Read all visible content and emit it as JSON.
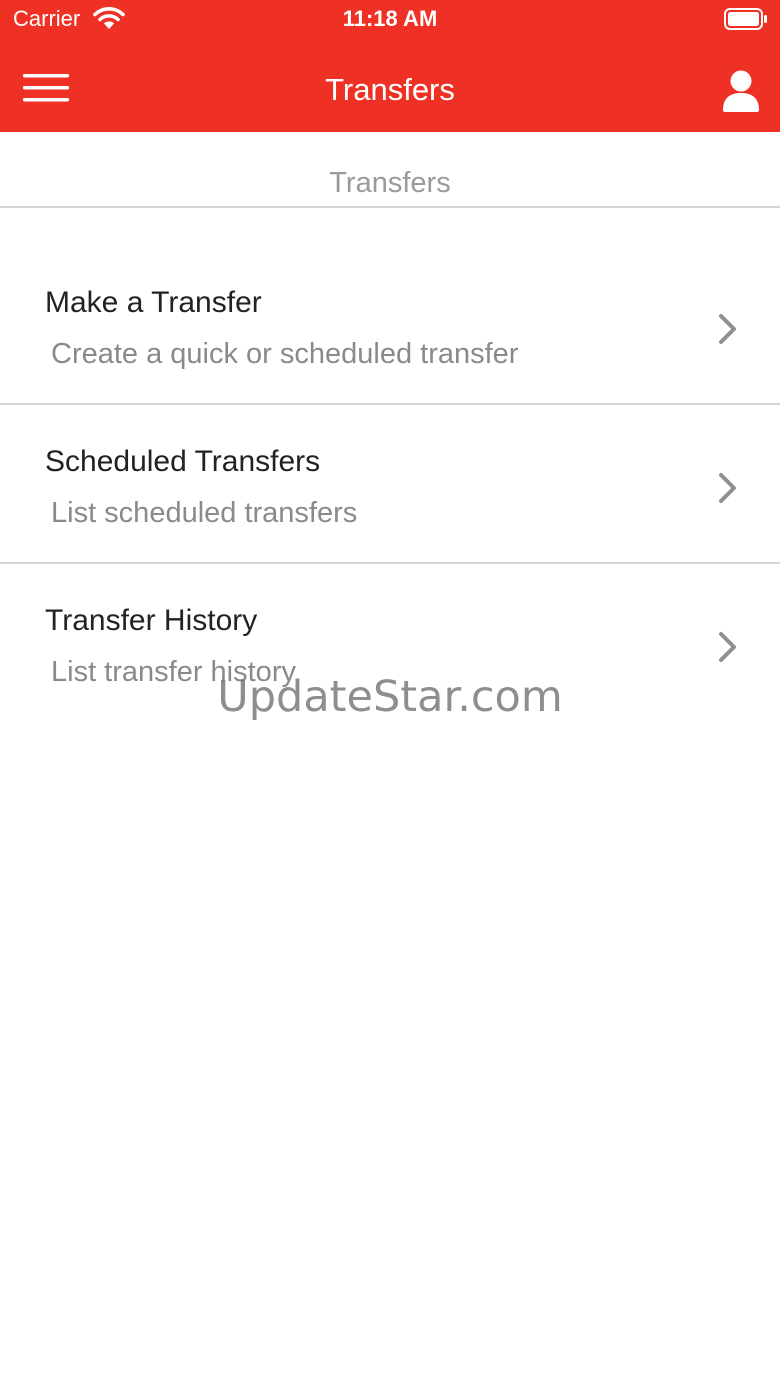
{
  "status_bar": {
    "carrier": "Carrier",
    "time": "11:18 AM",
    "wifi_icon": "wifi-icon",
    "battery_icon": "battery-icon"
  },
  "nav_bar": {
    "title": "Transfers",
    "menu_icon": "hamburger-menu-icon",
    "profile_icon": "user-profile-icon"
  },
  "section": {
    "title": "Transfers"
  },
  "menu": {
    "items": [
      {
        "title": "Make a Transfer",
        "subtitle": "Create a quick or scheduled transfer",
        "icon": "chevron-right-icon"
      },
      {
        "title": "Scheduled Transfers",
        "subtitle": "List scheduled transfers",
        "icon": "chevron-right-icon"
      },
      {
        "title": "Transfer History",
        "subtitle": "List transfer history",
        "icon": "chevron-right-icon"
      }
    ]
  },
  "watermark": "UpdateStar.com",
  "colors": {
    "brand_red": "#ee3124",
    "divider": "#d4d4d4",
    "title_text": "#222222",
    "subtitle_text": "#8a8a8a",
    "chevron": "#8e8e93"
  }
}
